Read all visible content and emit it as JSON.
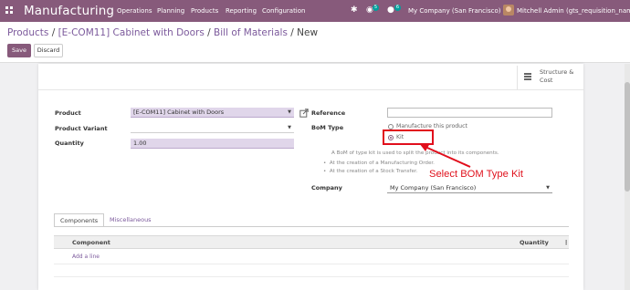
{
  "navbar": {
    "brand": "Manufacturing",
    "menu": [
      "Operations",
      "Planning",
      "Products",
      "Reporting",
      "Configuration"
    ],
    "chat_badge": "5",
    "activity_badge": "6",
    "company": "My Company (San Francisco)",
    "user": "Mitchell Admin (gts_requisition_name)",
    "bg_color": "#875a7b"
  },
  "breadcrumb": {
    "items": [
      "Products",
      "[E-COM11] Cabinet with Doors",
      "Bill of Materials"
    ],
    "current": "New",
    "separator": "/"
  },
  "buttons": {
    "save": "Save",
    "discard": "Discard"
  },
  "smart_button": {
    "label": "Structure &\nCost",
    "icon": "bars-icon"
  },
  "form": {
    "product": {
      "label": "Product",
      "value": "[E-COM11] Cabinet with Doors"
    },
    "variant": {
      "label": "Product Variant",
      "value": ""
    },
    "quantity": {
      "label": "Quantity",
      "value": "1.00"
    },
    "reference": {
      "label": "Reference",
      "value": ""
    },
    "bom_type": {
      "label": "BoM Type",
      "options": [
        "Manufacture this product",
        "Kit"
      ],
      "selected": "Kit",
      "help": "A BoM of type kit is used to split the product into its components.",
      "bullets": [
        "At the creation of a Manufacturing Order.",
        "At the creation of a Stock Transfer."
      ]
    },
    "company": {
      "label": "Company",
      "value": "My Company (San Francisco)"
    }
  },
  "annotation": {
    "text": "Select BOM Type Kit",
    "color": "#e10e1c"
  },
  "notebook": {
    "tabs": [
      "Components",
      "Miscellaneous"
    ],
    "active_tab": "Components",
    "columns": [
      "Component",
      "Quantity"
    ],
    "add_line": "Add a line"
  }
}
